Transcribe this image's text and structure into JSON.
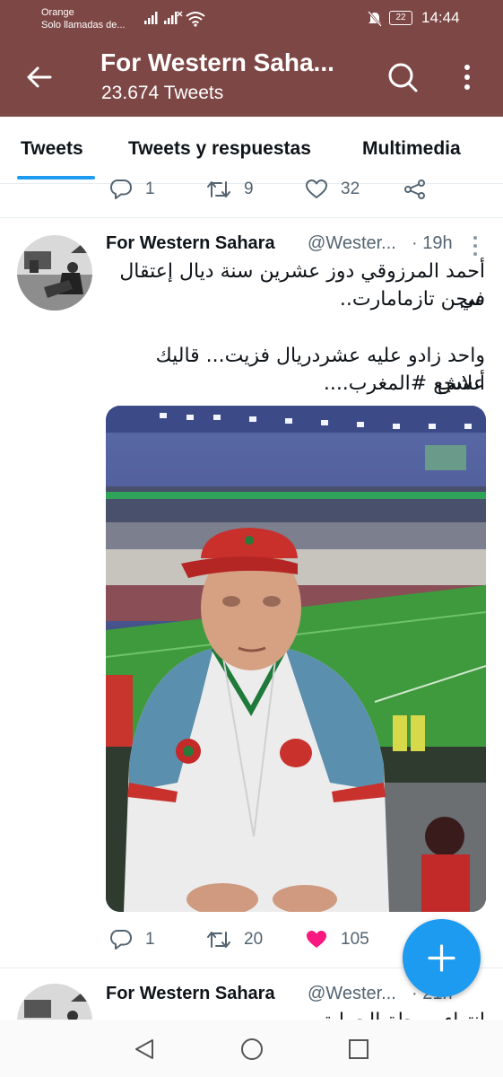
{
  "status": {
    "carrier": "Orange",
    "carrier_note": "Solo llamadas de...",
    "battery": "22",
    "time": "14:44"
  },
  "header": {
    "title": "For Western Saha...",
    "subtitle": "23.674 Tweets"
  },
  "tabs": [
    "Tweets",
    "Tweets y respuestas",
    "Multimedia"
  ],
  "prev_tweet_actions": {
    "replies": "1",
    "retweets": "9",
    "likes": "32"
  },
  "tweet": {
    "name": "For Western Sahara",
    "handle": "@Wester...",
    "time": "· 19h",
    "text_line1": "أحمد المرزوقي دوز عشرين سنة ديال إعتقال في",
    "text_line2": "سجن تازمامارت..",
    "text_line3": "واحد زادو عليه عشردريال فزيت... قاليك علاش",
    "text_line4": "أنشجع #المغرب....",
    "replies": "1",
    "retweets": "20",
    "likes": "105"
  },
  "next_tweet": {
    "name": "For Western Sahara",
    "handle": "@Wester...",
    "time": "· 21h",
    "text_partial": "انتهاء مرحلة الحماية"
  },
  "colors": {
    "header_bg": "#7d4745",
    "accent": "#1d9bf0",
    "like": "#f91880"
  },
  "icons": [
    "back-arrow-icon",
    "search-icon",
    "more-vert-icon",
    "reply-icon",
    "retweet-icon",
    "heart-icon",
    "share-icon",
    "plus-icon"
  ]
}
